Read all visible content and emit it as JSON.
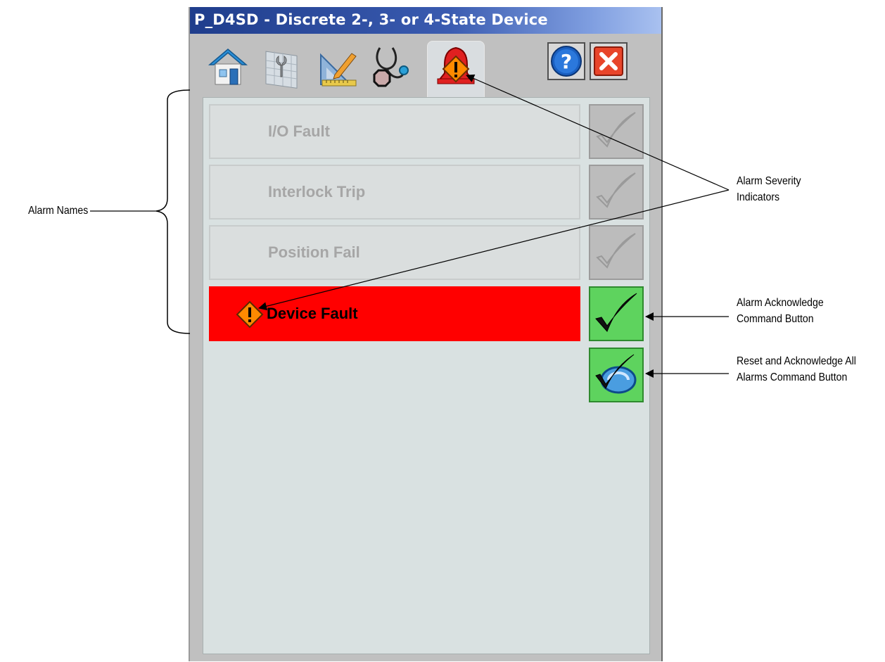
{
  "window": {
    "title": "P_D4SD - Discrete 2-, 3- or 4-State Device",
    "tabs": [
      "home-icon",
      "maintenance-icon",
      "engineering-icon",
      "diagnostics-icon",
      "alarms-icon"
    ],
    "active_tab": "alarms-icon",
    "help_button": "help-icon",
    "close_button": "close-icon"
  },
  "alarms": [
    {
      "label": "I/O Fault",
      "active": false
    },
    {
      "label": "Interlock Trip",
      "active": false
    },
    {
      "label": "Position Fail",
      "active": false
    },
    {
      "label": "Device Fault",
      "active": true
    }
  ],
  "buttons": {
    "acknowledge": "checkmark-icon",
    "reset_ack_all": "reset-acknowledge-icon"
  },
  "annotations": {
    "alarm_names": "Alarm Names",
    "severity_line1": "Alarm Severity",
    "severity_line2": "Indicators",
    "ack_line1": "Alarm Acknowledge",
    "ack_line2": "Command Button",
    "reset_line1": "Reset and Acknowledge All",
    "reset_line2": "Alarms Command Button"
  },
  "colors": {
    "active_alarm": "#ff0000",
    "inactive_alarm_text": "#a6a6a6",
    "panel": "#d9e1e1",
    "ack_button_active": "#5ed35e",
    "title_bar": "#1f3d8c"
  }
}
